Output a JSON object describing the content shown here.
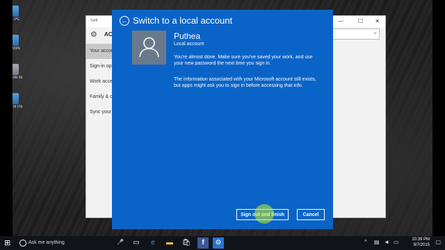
{
  "desktop": {
    "icons": [
      {
        "label": "This PC"
      },
      {
        "label": "Network"
      },
      {
        "label": "Recycle Bin"
      },
      {
        "label": "Control Panel"
      }
    ]
  },
  "settings_window": {
    "header": "ACC",
    "back_label": "Sett",
    "nav": [
      {
        "label": "Your accou",
        "active": true
      },
      {
        "label": "Sign-in op"
      },
      {
        "label": "Work acce"
      },
      {
        "label": "Family & o"
      },
      {
        "label": "Sync your s"
      }
    ],
    "controls": {
      "minimize": "—",
      "maximize": "☐",
      "close": "✕"
    },
    "search_icon": "⌕"
  },
  "dialog": {
    "title": "Switch to a local account",
    "back_icon": "back-arrow-icon",
    "user_name": "Puthea",
    "account_type": "Local account",
    "message1": "You're almost done. Make sure you've saved your work, and use your new password the next time you sign in.",
    "message2": "The information associated with your Microsoft account still exists, but apps might ask you to sign in before accessing that info.",
    "sign_out_button": "Sign out and finish",
    "cancel_button": "Cancel",
    "accent": "#0a64c8"
  },
  "taskbar": {
    "search_placeholder": "Ask me anything",
    "time": "10:39 PM",
    "date": "9/7/2015",
    "mic_icon": "🎤",
    "apps": [
      "task-view-icon",
      "edge-icon",
      "file-explorer-icon",
      "store-icon",
      "facebook-icon",
      "settings-icon"
    ]
  }
}
